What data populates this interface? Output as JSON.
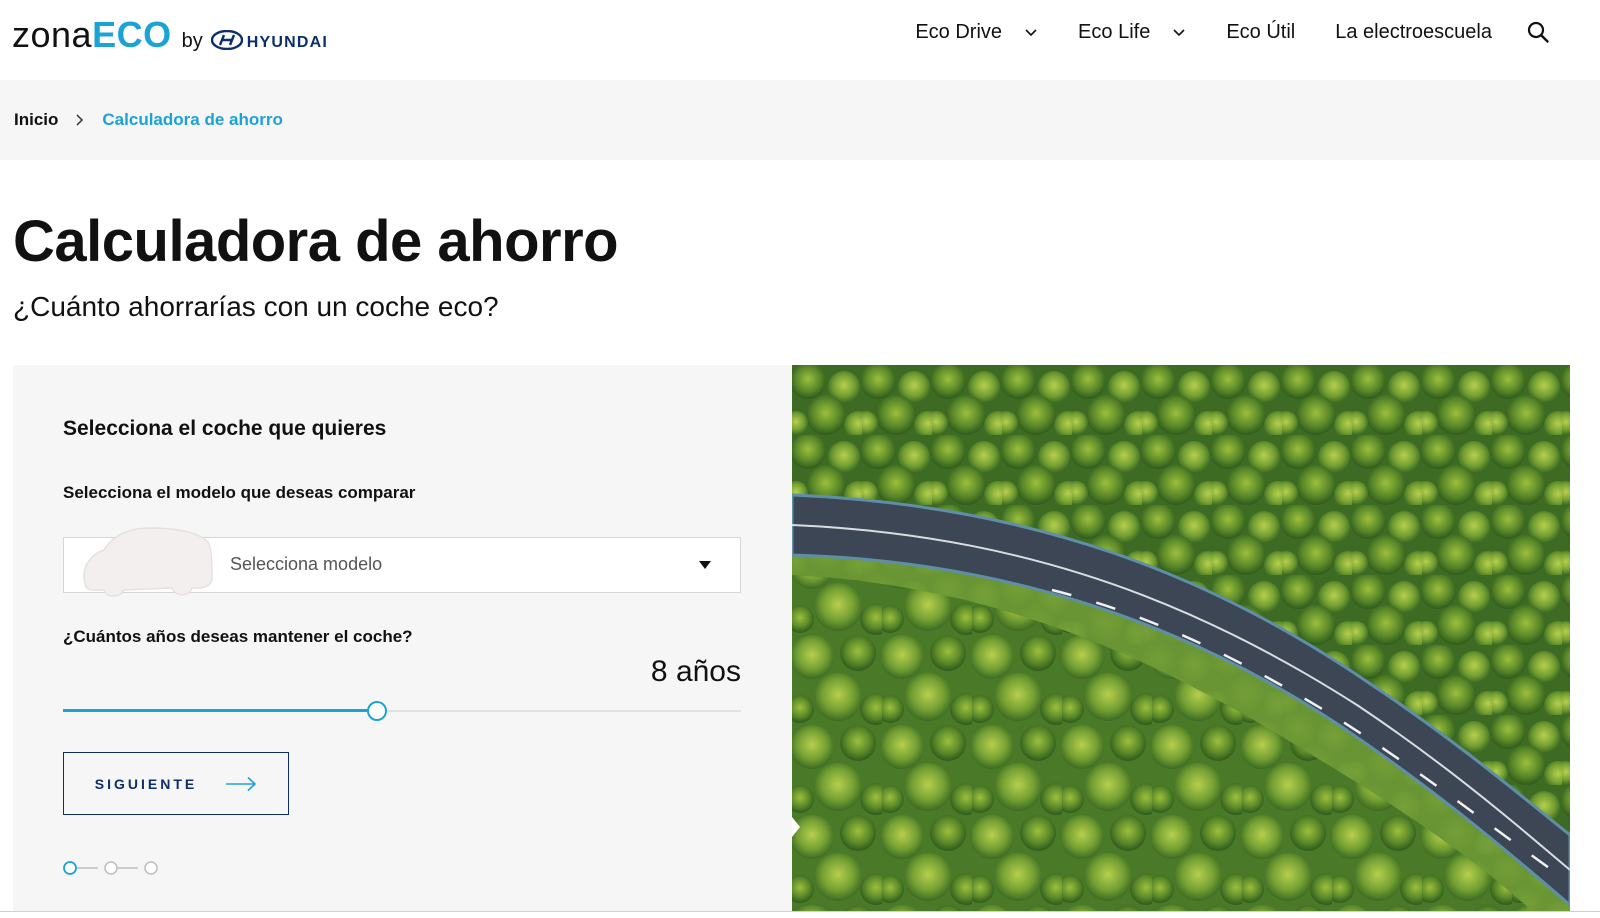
{
  "header": {
    "logo": {
      "zona": "zona",
      "eco": "ECO",
      "by": "by",
      "hyundai": "HYUNDAI"
    },
    "nav": [
      {
        "label": "Eco Drive",
        "has_dropdown": true
      },
      {
        "label": "Eco Life",
        "has_dropdown": true
      },
      {
        "label": "Eco Útil",
        "has_dropdown": false
      },
      {
        "label": "La electroescuela",
        "has_dropdown": false
      }
    ],
    "search_icon": "search-icon"
  },
  "breadcrumb": {
    "home": "Inicio",
    "current": "Calculadora de ahorro"
  },
  "page": {
    "title": "Calculadora de ahorro",
    "subtitle": "¿Cuánto ahorrarías con un coche eco?"
  },
  "calculator": {
    "heading": "Selecciona el coche que quieres",
    "model_label": "Selecciona el modelo que deseas comparar",
    "model_placeholder": "Selecciona modelo",
    "years_label": "¿Cuántos años deseas mantener el coche?",
    "years_value": "8 años",
    "slider_fraction": 0.463,
    "next_label": "SIGUIENTE",
    "steps": {
      "total": 3,
      "current": 1
    }
  },
  "colors": {
    "accent": "#1ca3d6",
    "navy": "#0c2f6b",
    "panel_bg": "#f6f6f6"
  }
}
